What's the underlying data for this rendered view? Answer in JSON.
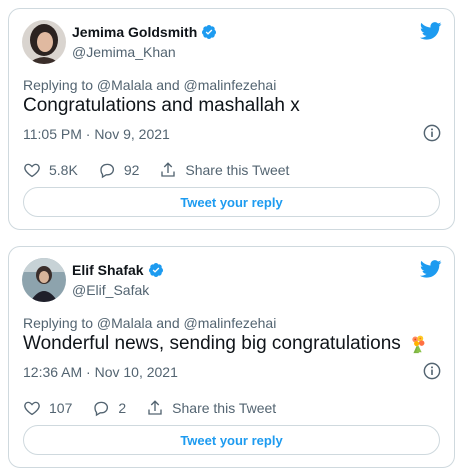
{
  "tweets": [
    {
      "author_name": "Jemima Goldsmith",
      "author_handle": "@Jemima_Khan",
      "reply_to": "Replying to @Malala and @malinfezehai",
      "text": "Congratulations and mashallah x",
      "timestamp": "11:05 PM · Nov 9, 2021",
      "likes": "5.8K",
      "replies": "92",
      "share_label": "Share this Tweet",
      "reply_button_label": "Tweet your reply",
      "has_emoji": false
    },
    {
      "author_name": "Elif Shafak",
      "author_handle": "@Elif_Safak",
      "reply_to": "Replying to @Malala and @malinfezehai",
      "text": "Wonderful news, sending big congratulations",
      "timestamp": "12:36 AM · Nov 10, 2021",
      "likes": "107",
      "replies": "2",
      "share_label": "Share this Tweet",
      "reply_button_label": "Tweet your reply",
      "has_emoji": true,
      "emoji_icon": "bouquet-icon"
    }
  ],
  "colors": {
    "accent": "#1d9bf0",
    "text_primary": "#0f1419",
    "text_secondary": "#536471",
    "border": "#cfd9de"
  },
  "icons": [
    "verified-badge-icon",
    "twitter-bird-icon",
    "info-icon",
    "heart-icon",
    "reply-bubble-icon",
    "share-icon",
    "bouquet-icon"
  ]
}
